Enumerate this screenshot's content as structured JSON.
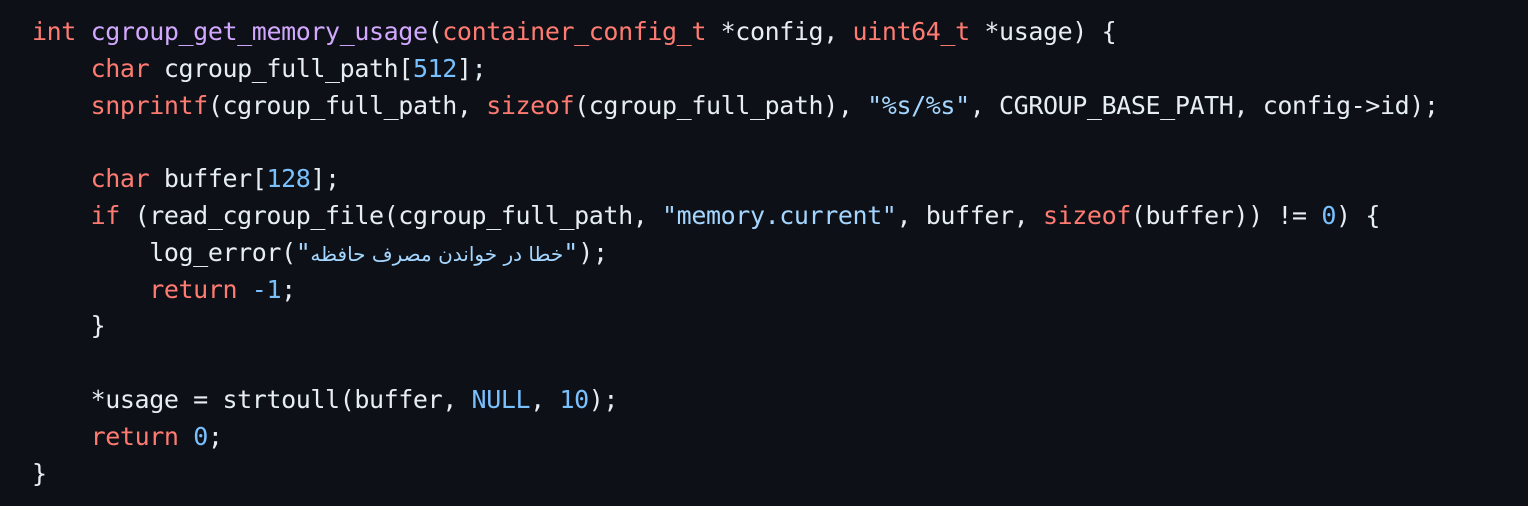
{
  "theme": {
    "background": "#0d1117",
    "foreground": "#e6edf3",
    "keyword": "#ff7b72",
    "function": "#d2a8ff",
    "number": "#79c0ff",
    "string": "#a5d6ff"
  },
  "code": {
    "language": "c",
    "lines": [
      [
        {
          "t": "int",
          "c": "kw"
        },
        {
          "t": " ",
          "c": "id"
        },
        {
          "t": "cgroup_get_memory_usage",
          "c": "fn"
        },
        {
          "t": "(",
          "c": "id"
        },
        {
          "t": "container_config_t",
          "c": "kw"
        },
        {
          "t": " *config, ",
          "c": "id"
        },
        {
          "t": "uint64_t",
          "c": "kw"
        },
        {
          "t": " *usage) {",
          "c": "id"
        }
      ],
      [
        {
          "t": "    ",
          "c": "id"
        },
        {
          "t": "char",
          "c": "kw"
        },
        {
          "t": " cgroup_full_path[",
          "c": "id"
        },
        {
          "t": "512",
          "c": "num"
        },
        {
          "t": "];",
          "c": "id"
        }
      ],
      [
        {
          "t": "    ",
          "c": "id"
        },
        {
          "t": "snprintf",
          "c": "kw"
        },
        {
          "t": "(cgroup_full_path, ",
          "c": "id"
        },
        {
          "t": "sizeof",
          "c": "kw"
        },
        {
          "t": "(cgroup_full_path), ",
          "c": "id"
        },
        {
          "t": "\"%s/%s\"",
          "c": "str"
        },
        {
          "t": ", CGROUP_BASE_PATH, config->id);",
          "c": "id"
        }
      ],
      [
        {
          "t": "",
          "c": "id"
        }
      ],
      [
        {
          "t": "    ",
          "c": "id"
        },
        {
          "t": "char",
          "c": "kw"
        },
        {
          "t": " buffer[",
          "c": "id"
        },
        {
          "t": "128",
          "c": "num"
        },
        {
          "t": "];",
          "c": "id"
        }
      ],
      [
        {
          "t": "    ",
          "c": "id"
        },
        {
          "t": "if",
          "c": "kw"
        },
        {
          "t": " (read_cgroup_file(cgroup_full_path, ",
          "c": "id"
        },
        {
          "t": "\"memory.current\"",
          "c": "str"
        },
        {
          "t": ", buffer, ",
          "c": "id"
        },
        {
          "t": "sizeof",
          "c": "kw"
        },
        {
          "t": "(buffer)) != ",
          "c": "id"
        },
        {
          "t": "0",
          "c": "num"
        },
        {
          "t": ") {",
          "c": "id"
        }
      ],
      [
        {
          "t": "        log_error(",
          "c": "id"
        },
        {
          "t": "\"خطا در خواندن مصرف حافظه\"",
          "c": "str",
          "rtl": true
        },
        {
          "t": ");",
          "c": "id"
        }
      ],
      [
        {
          "t": "        ",
          "c": "id"
        },
        {
          "t": "return",
          "c": "kw"
        },
        {
          "t": " ",
          "c": "id"
        },
        {
          "t": "-1",
          "c": "num"
        },
        {
          "t": ";",
          "c": "id"
        }
      ],
      [
        {
          "t": "    }",
          "c": "id"
        }
      ],
      [
        {
          "t": "",
          "c": "id"
        }
      ],
      [
        {
          "t": "    *usage = strtoull(buffer, ",
          "c": "id"
        },
        {
          "t": "NULL",
          "c": "num"
        },
        {
          "t": ", ",
          "c": "id"
        },
        {
          "t": "10",
          "c": "num"
        },
        {
          "t": ");",
          "c": "id"
        }
      ],
      [
        {
          "t": "    ",
          "c": "id"
        },
        {
          "t": "return",
          "c": "kw"
        },
        {
          "t": " ",
          "c": "id"
        },
        {
          "t": "0",
          "c": "num"
        },
        {
          "t": ";",
          "c": "id"
        }
      ],
      [
        {
          "t": "}",
          "c": "id"
        }
      ]
    ]
  }
}
